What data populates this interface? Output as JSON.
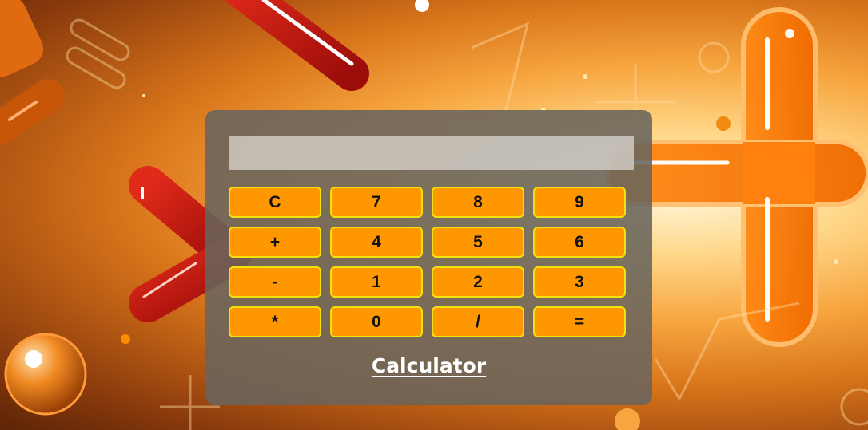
{
  "calculator": {
    "display_value": "",
    "title": "Calculator",
    "keys": [
      [
        "C",
        "7",
        "8",
        "9"
      ],
      [
        "+",
        "4",
        "5",
        "6"
      ],
      [
        "-",
        "1",
        "2",
        "3"
      ],
      [
        "*",
        "0",
        "/",
        "="
      ]
    ]
  },
  "colors": {
    "key_fill": "#ff9800",
    "key_border": "#f2e20a",
    "panel": "#69645c"
  }
}
